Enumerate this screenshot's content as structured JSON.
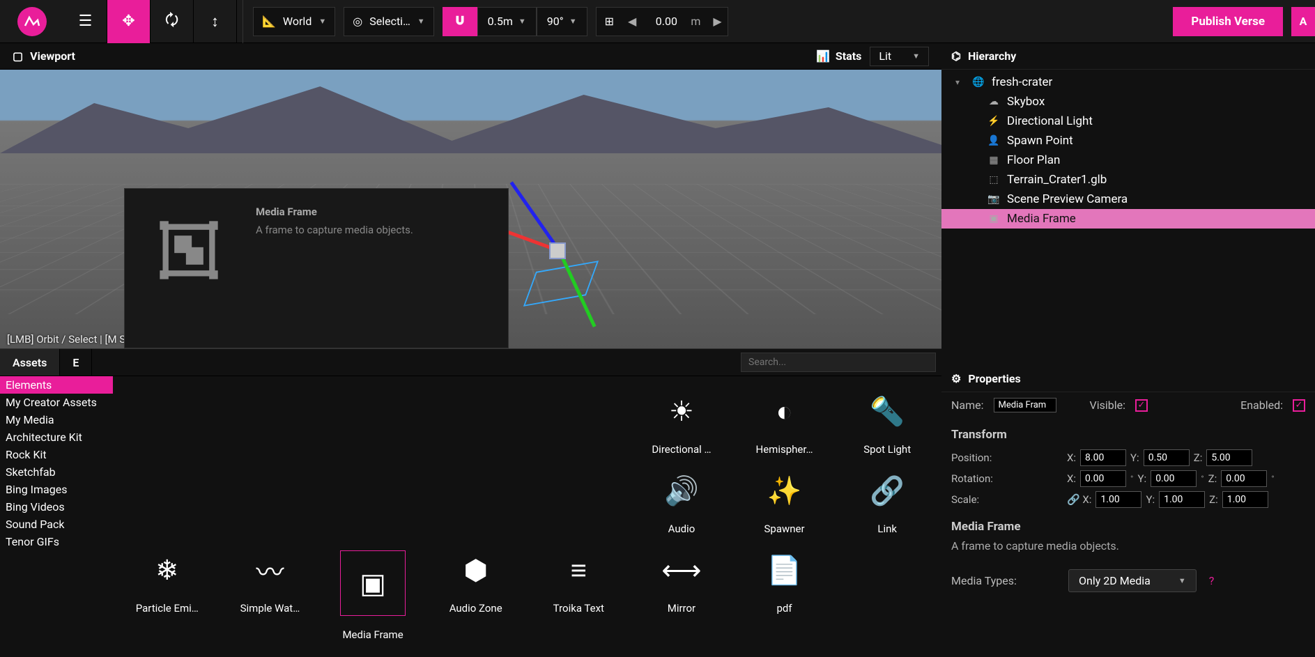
{
  "topbar": {
    "transform_space": "World",
    "pivot": "Selecti…",
    "snap_linear": "0.5m",
    "snap_angle": "90°",
    "grid_value": "0.00",
    "grid_unit": "m",
    "publish_label": "Publish Verse",
    "avatar_initial": "A"
  },
  "viewport": {
    "title": "Viewport",
    "stats_label": "Stats",
    "render_mode": "Lit",
    "help_text": "[LMB] Orbit / Select | [M                                                                                                                  SC] Deselect All"
  },
  "tooltip": {
    "title": "Media Frame",
    "text": "A frame to capture media objects."
  },
  "assets": {
    "tab1": "Assets",
    "tab2": "E",
    "search_placeholder": "Search...",
    "categories": [
      "Elements",
      "My Creator Assets",
      "My Media",
      "Architecture Kit",
      "Rock Kit",
      "Sketchfab",
      "Bing Images",
      "Bing Videos",
      "Sound Pack",
      "Tenor GIFs"
    ],
    "selected_category": 0,
    "elements_row1": [
      "",
      "",
      "",
      "",
      "",
      "Directional …",
      "Hemispher…",
      "Spot Light"
    ],
    "elements_row2": [
      "",
      "",
      "",
      "",
      "",
      "Audio",
      "Spawner",
      "Link"
    ],
    "elements_row3": [
      "Particle Emi…",
      "Simple Wat…",
      "Media Frame",
      "Audio Zone",
      "Troika Text",
      "Mirror",
      "pdf"
    ],
    "selected_element": "Media Frame"
  },
  "hierarchy": {
    "title": "Hierarchy",
    "root": "fresh-crater",
    "children": [
      "Skybox",
      "Directional Light",
      "Spawn Point",
      "Floor Plan",
      "Terrain_Crater1.glb",
      "Scene Preview Camera",
      "Media Frame"
    ],
    "selected": "Media Frame"
  },
  "properties": {
    "title": "Properties",
    "name_label": "Name:",
    "name_value": "Media Fram",
    "visible_label": "Visible:",
    "visible": true,
    "enabled_label": "Enabled:",
    "enabled": true,
    "transform_title": "Transform",
    "position_label": "Position:",
    "position": {
      "x": "8.00",
      "y": "0.50",
      "z": "5.00"
    },
    "rotation_label": "Rotation:",
    "rotation": {
      "x": "0.00",
      "y": "0.00",
      "z": "0.00"
    },
    "scale_label": "Scale:",
    "scale": {
      "x": "1.00",
      "y": "1.00",
      "z": "1.00"
    },
    "section_title": "Media Frame",
    "section_desc": "A frame to capture media objects.",
    "media_types_label": "Media Types:",
    "media_types_value": "Only 2D Media"
  }
}
